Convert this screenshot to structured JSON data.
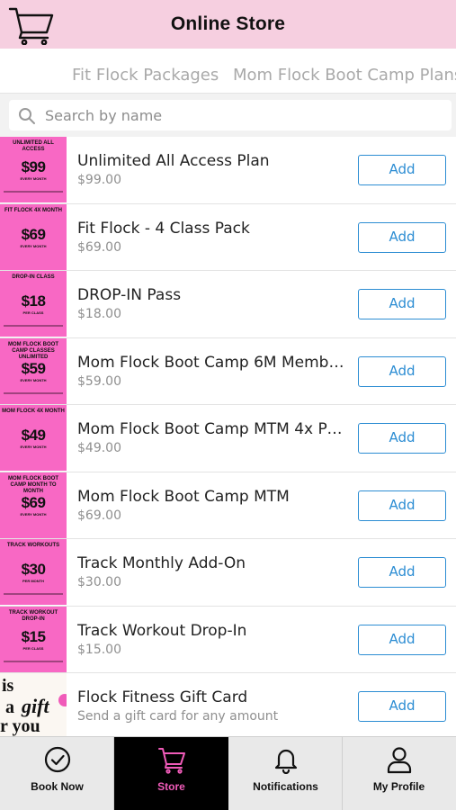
{
  "header": {
    "title": "Online Store",
    "cart_icon": "cart-icon"
  },
  "tabs": [
    {
      "label": "Fit Flock Packages"
    },
    {
      "label": "Mom Flock Boot Camp Plans/P"
    }
  ],
  "search": {
    "placeholder": "Search by name",
    "icon": "search-icon"
  },
  "colors": {
    "header_bg": "#f6cfe0",
    "thumb_pink": "#f868c4",
    "accent_blue": "#2c8dd3",
    "active_nav_bg": "#000000",
    "active_nav_fg": "#f05bb9"
  },
  "products": [
    {
      "name": "Unlimited All Access Plan",
      "price": "$99.00",
      "button": "Add",
      "thumb": {
        "label": "Unlimited All Access",
        "price": "$99",
        "unit": "Every Month"
      }
    },
    {
      "name": "Fit Flock - 4 Class Pack",
      "price": "$69.00",
      "button": "Add",
      "thumb": {
        "label": "Fit Flock 4x Month",
        "price": "$69",
        "unit": "Every Month"
      }
    },
    {
      "name": "DROP-IN Pass",
      "price": "$18.00",
      "button": "Add",
      "thumb": {
        "label": "Drop-In Class",
        "price": "$18",
        "unit": "Per Class"
      }
    },
    {
      "name": "Mom Flock Boot Camp 6M Membe...",
      "price": "$59.00",
      "button": "Add",
      "thumb": {
        "label": "Mom Flock Boot Camp Classes Unlimited",
        "price": "$59",
        "unit": "Every Month"
      }
    },
    {
      "name": "Mom Flock Boot Camp MTM 4x Pu...",
      "price": "$49.00",
      "button": "Add",
      "thumb": {
        "label": "Mom Flock 4x Month",
        "price": "$49",
        "unit": "Every Month"
      }
    },
    {
      "name": "Mom Flock Boot Camp MTM",
      "price": "$69.00",
      "button": "Add",
      "thumb": {
        "label": "Mom Flock Boot Camp Month to Month",
        "price": "$69",
        "unit": "Every Month"
      }
    },
    {
      "name": "Track Monthly Add-On",
      "price": "$30.00",
      "button": "Add",
      "thumb": {
        "label": "Track Workouts",
        "price": "$30",
        "unit": "Per Month"
      }
    },
    {
      "name": "Track Workout Drop-In",
      "price": "$15.00",
      "button": "Add",
      "thumb": {
        "label": "Track Workout Drop-In",
        "price": "$15",
        "unit": "Per Class"
      }
    },
    {
      "name": "Flock Fitness Gift Card",
      "price": "Send a gift card for any amount",
      "button": "Add",
      "thumb": {
        "label": "",
        "price": "",
        "unit": ""
      }
    }
  ],
  "bottom_nav": [
    {
      "label": "Book Now",
      "icon": "check-circle-icon",
      "active": false
    },
    {
      "label": "Store",
      "icon": "cart-icon",
      "active": true
    },
    {
      "label": "Notifications",
      "icon": "bell-icon",
      "active": false
    },
    {
      "label": "My Profile",
      "icon": "user-icon",
      "active": false
    }
  ]
}
